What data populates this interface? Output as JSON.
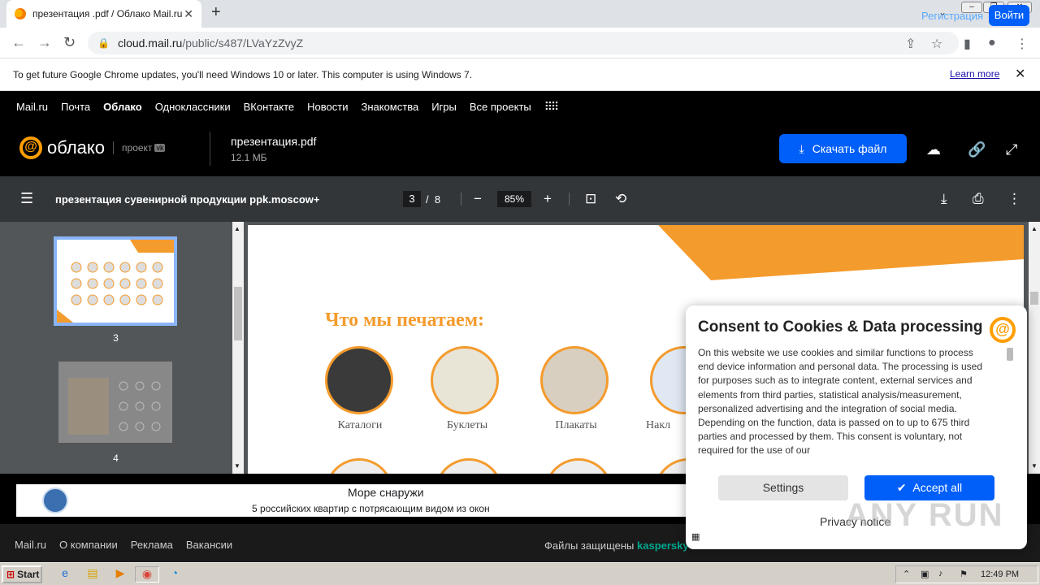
{
  "browser": {
    "tab_title": "презентация .pdf / Облако Mail.ru",
    "url_host": "cloud.mail.ru",
    "url_path": "/public/s487/LVaYzZvyZ",
    "infobar_text": "To get future Google Chrome updates, you'll need Windows 10 or later. This computer is using Windows 7.",
    "infobar_link": "Learn more"
  },
  "mailnav": {
    "items": [
      "Mail.ru",
      "Почта",
      "Облако",
      "Одноклассники",
      "ВКонтакте",
      "Новости",
      "Знакомства",
      "Игры",
      "Все проекты"
    ],
    "register": "Регистрация",
    "login": "Войти"
  },
  "cloud": {
    "logo_word": "облако",
    "project": "проект",
    "file_name": "презентация.pdf",
    "file_size": "12.1 МБ",
    "download_label": "Скачать файл"
  },
  "pdf": {
    "title": "презентация сувенирной продукции ppk.moscow+",
    "current_page": "3",
    "total_pages": "8",
    "zoom": "85%",
    "thumb_labels": [
      "3",
      "4"
    ],
    "heading": "Что мы печатаем:",
    "items": [
      "Каталоги",
      "Буклеты",
      "Плакаты",
      "Накл"
    ]
  },
  "ad": {
    "title": "Море снаружи",
    "subtitle": "5 российских квартир с потрясающим видом из окон"
  },
  "footer": {
    "links": [
      "Mail.ru",
      "О компании",
      "Реклама",
      "Вакансии"
    ],
    "protected": "Файлы защищены",
    "kaspersky": "kaspersky"
  },
  "cookie": {
    "title": "Consent to Cookies & Data processing",
    "body": "On this website we use cookies and similar functions to process end device information and personal data. The processing is used for purposes such as to integrate content, external services and elements from third parties, statistical analysis/measurement, personalized advertising and the integration of social media. Depending on the function, data is passed on to up to 675 third parties and processed by them. This consent is voluntary, not required for the use of our",
    "settings": "Settings",
    "accept": "Accept all",
    "privacy": "Privacy notice"
  },
  "watermark": "ANY RUN",
  "taskbar": {
    "start": "Start",
    "clock": "12:49 PM"
  },
  "colors": {
    "accent_blue": "#005ff9",
    "mail_orange": "#ff9e00",
    "page_orange": "#f49b2d"
  }
}
